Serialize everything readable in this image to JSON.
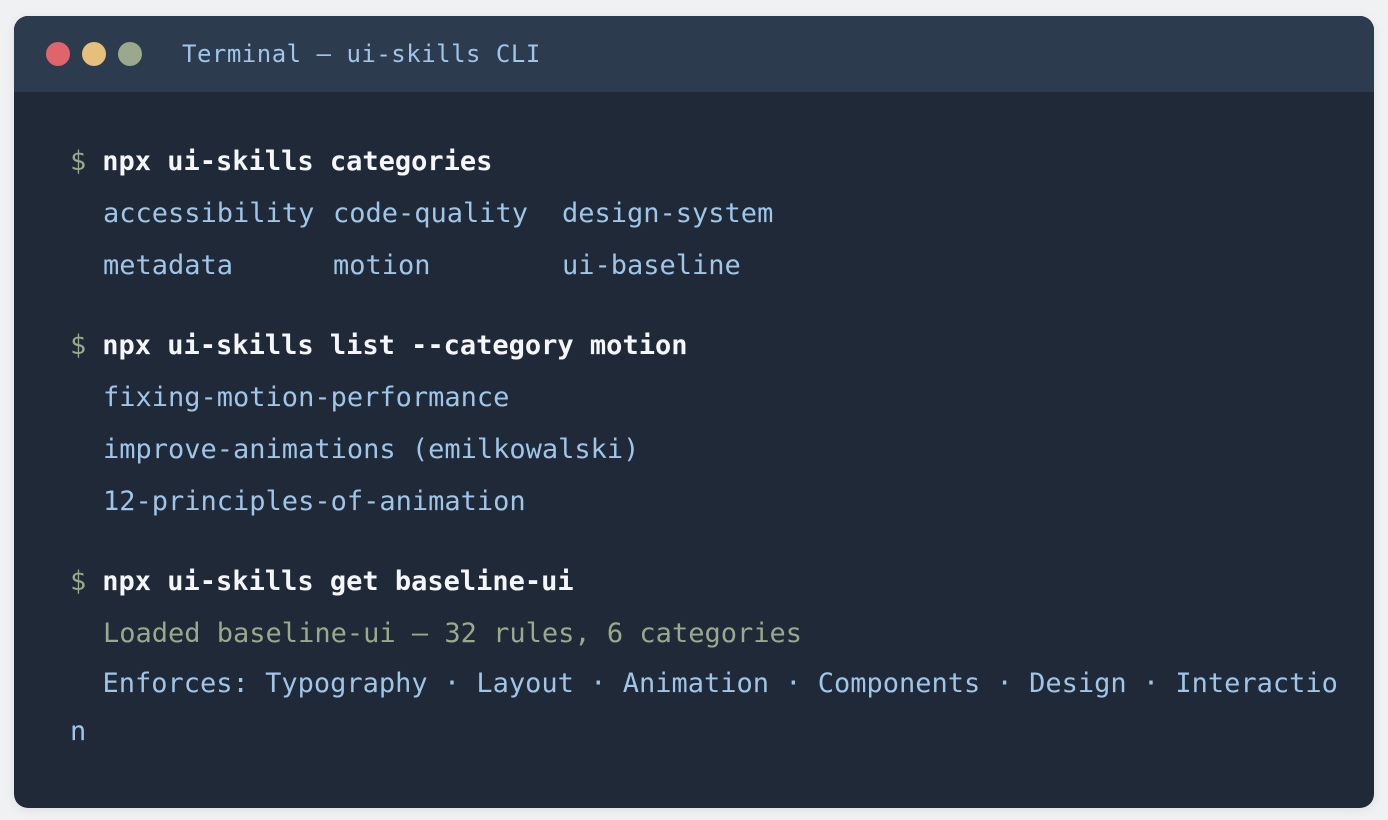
{
  "window": {
    "title": "Terminal — ui-skills CLI"
  },
  "commands": [
    {
      "prompt": "$",
      "command": "npx ui-skills categories",
      "output_grid": [
        [
          "accessibility",
          "code-quality",
          "design-system"
        ],
        [
          "metadata",
          "motion",
          "ui-baseline"
        ]
      ]
    },
    {
      "prompt": "$",
      "command": "npx ui-skills list --category motion",
      "output_lines": [
        "fixing-motion-performance",
        "improve-animations (emilkowalski)",
        "12-principles-of-animation"
      ]
    },
    {
      "prompt": "$",
      "command": "npx ui-skills get baseline-ui",
      "status_line": "Loaded baseline-ui — 32 rules, 6 categories",
      "enforces_line": "  Enforces: Typography · Layout · Animation · Components · Design · Interaction"
    }
  ],
  "colors": {
    "terminal_bg": "#1f2937",
    "titlebar_bg": "#2d3b4f",
    "command_text": "#f4f6f8",
    "output_text": "#9fc5e8",
    "status_text": "#9aa88c",
    "dot_close": "#e0656b",
    "dot_minimize": "#e6c07b",
    "dot_maximize": "#9aa88c"
  }
}
